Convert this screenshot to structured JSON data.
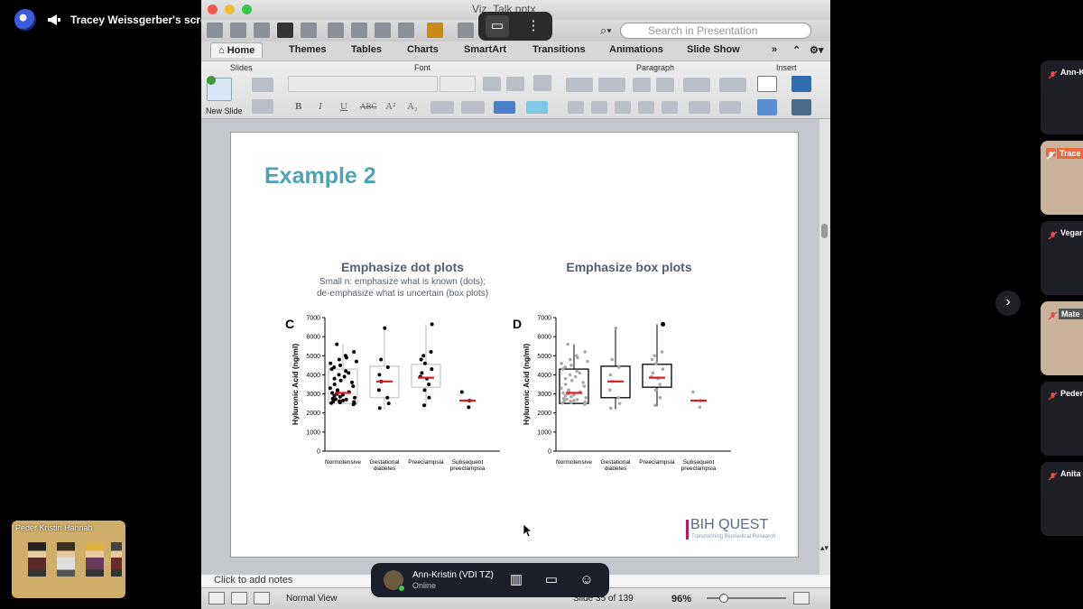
{
  "meeting": {
    "share_label": "Tracey Weissgerber's screen"
  },
  "app": {
    "doc_title": "Viz_Talk.pptx",
    "search_placeholder": "Search in Presentation",
    "tabs": [
      "Home",
      "Themes",
      "Tables",
      "Charts",
      "SmartArt",
      "Transitions",
      "Animations",
      "Slide Show"
    ],
    "groups": [
      "Slides",
      "Font",
      "Paragraph",
      "Insert"
    ],
    "new_slide_label": "New Slide",
    "font_buttons": [
      "B",
      "I",
      "U",
      "ABC",
      "A²",
      "A₂"
    ],
    "notes_placeholder": "Click to add notes",
    "view_label": "Normal View",
    "slide_counter": "Slide 35 of 139",
    "zoom": "96%"
  },
  "slide": {
    "title": "Example 2",
    "chart_data": [
      {
        "type": "scatter",
        "panel_label": "C",
        "title": "Emphasize dot plots",
        "subtitle_lines": [
          "Small n: emphasize what is known (dots);",
          "de-emphasize what is uncertain (box plots)"
        ],
        "ylabel": "Hyluronic Acid (ng/ml)",
        "ylim": [
          0,
          7000
        ],
        "yticks": [
          "0",
          "1000",
          "2000",
          "3000",
          "4000",
          "5000",
          "6000",
          "7000"
        ],
        "categories": [
          "Normotensive",
          "Gestational diabetes",
          "Preeclampsia",
          "Subsequent preeclampsia"
        ],
        "medians": [
          3050,
          3650,
          3850,
          2650
        ],
        "boxes": [
          {
            "q1": 2500,
            "q3": 4300,
            "min": 2450,
            "max": 5600
          },
          {
            "q1": 2800,
            "q3": 4450,
            "min": 2200,
            "max": 6450
          },
          {
            "q1": 3350,
            "q3": 4550,
            "min": 2350,
            "max": 6650
          },
          null
        ],
        "points": [
          [
            2450,
            2500,
            2520,
            2550,
            2580,
            2600,
            2620,
            2650,
            2700,
            2720,
            2750,
            2800,
            2850,
            2900,
            2950,
            3000,
            3050,
            3100,
            3150,
            3200,
            3300,
            3400,
            3500,
            3600,
            3700,
            3800,
            3900,
            4000,
            4100,
            4200,
            4300,
            4400,
            4500,
            4600,
            4700,
            4800,
            4900,
            5000,
            5200,
            5600
          ],
          [
            2250,
            2500,
            2800,
            3200,
            3650,
            4000,
            4400,
            4800,
            6450
          ],
          [
            2400,
            2800,
            3200,
            3500,
            3800,
            3900,
            4100,
            4300,
            4600,
            4800,
            5000,
            5200,
            6650
          ],
          [
            2300,
            2650,
            3100
          ]
        ],
        "emphasis": "dots"
      },
      {
        "type": "scatter",
        "panel_label": "D",
        "title": "Emphasize box plots",
        "ylabel": "Hyluronic Acid (ng/ml)",
        "ylim": [
          0,
          7000
        ],
        "yticks": [
          "0",
          "1000",
          "2000",
          "3000",
          "4000",
          "5000",
          "6000",
          "7000"
        ],
        "categories": [
          "Normotensive",
          "Gestational diabetes",
          "Preeclampsia",
          "Subsequent preeclampsia"
        ],
        "medians": [
          3050,
          3650,
          3850,
          2650
        ],
        "boxes": [
          {
            "q1": 2500,
            "q3": 4300,
            "min": 2450,
            "max": 5600
          },
          {
            "q1": 2800,
            "q3": 4450,
            "min": 2200,
            "max": 6450
          },
          {
            "q1": 3350,
            "q3": 4550,
            "min": 2350,
            "max": 6650
          },
          null
        ],
        "points": [
          [
            2450,
            2500,
            2520,
            2550,
            2580,
            2600,
            2620,
            2650,
            2700,
            2720,
            2750,
            2800,
            2850,
            2900,
            2950,
            3000,
            3050,
            3100,
            3150,
            3200,
            3300,
            3400,
            3500,
            3600,
            3700,
            3800,
            3900,
            4000,
            4100,
            4200,
            4300,
            4400,
            4500,
            4600,
            4700,
            4800,
            4900,
            5000,
            5200,
            5600
          ],
          [
            2250,
            2500,
            2800,
            3200,
            3650,
            4000,
            4400,
            4800,
            6450
          ],
          [
            2400,
            2800,
            3200,
            3500,
            3800,
            3900,
            4100,
            4300,
            4600,
            4800,
            5000,
            5200,
            6650
          ],
          [
            2300,
            2650,
            3100
          ]
        ],
        "emphasis": "boxes"
      }
    ],
    "logo_main": "BIH QUEST",
    "logo_sub": "Transforming Biomedical Research"
  },
  "pill": {
    "name": "Ann-Kristin (VDI TZ)",
    "status": "Online"
  },
  "participants": [
    {
      "name": "Ann-K",
      "video": false
    },
    {
      "name": "Trace",
      "video": true
    },
    {
      "name": "Vegar",
      "video": false
    },
    {
      "name": "Mate",
      "video": true
    },
    {
      "name": "Peder",
      "video": false
    },
    {
      "name": "Anita",
      "video": false
    }
  ],
  "minimap": {
    "label": "Peder Kristin Hannah"
  },
  "colors": {
    "accent_title": "#4ba3b5",
    "median": "#d62020",
    "logo_bar": "#c2185b"
  }
}
